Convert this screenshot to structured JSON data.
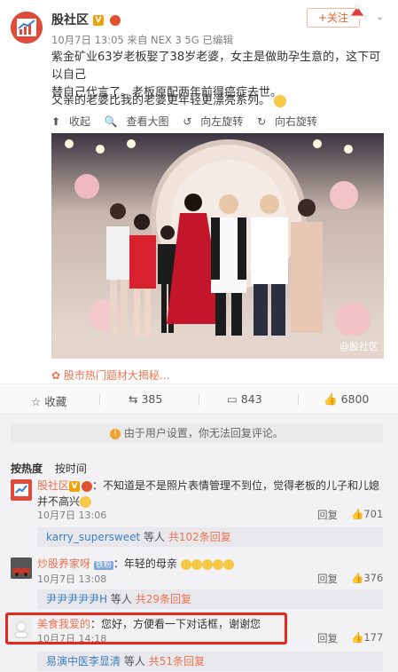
{
  "post": {
    "author": "股社区",
    "v_badge": "V",
    "meta": "10月7日 13:05 来自 NEX 3 5G  已编辑",
    "follow_label": "+关注",
    "text_line1": "紫金矿业63岁老板娶了38岁老婆，女主是做助孕生意的，这下可以自己",
    "text_line2": "替自己代言了。老板原配两年前得癌症去世。",
    "text_line3": "父亲的老婆比我的老婆更年轻更漂亮系列。",
    "toolbar": [
      "收起",
      "查看大图",
      "向左旋转",
      "向右旋转"
    ],
    "watermark": "@股社区",
    "promo": "股市热门题材大揭秘..."
  },
  "actions": {
    "favorite": "收藏",
    "repost": "385",
    "comment": "843",
    "like": "6800"
  },
  "notice": "由于用户设置，你无法回复评论。",
  "sort": [
    "按热度",
    "按时间"
  ],
  "comments": [
    {
      "user": "股社区",
      "text_line1": "：不知道是不是照片表情管理不到位，觉得老板的儿子和儿媳",
      "text_line2": "并不高兴",
      "time": "10月7日 13:06",
      "reply_label": "回复",
      "likes": "701",
      "subreply_user": "karry_supersweet",
      "subreply_mid": "等人",
      "subreply_count": "共102条回复"
    },
    {
      "user": "炒股养家呀",
      "badge": "铁粉",
      "text": "：年轻的母亲",
      "time": "10月7日 13:08",
      "reply_label": "回复",
      "likes": "376",
      "subreply_user": "尹尹尹尹尹H",
      "subreply_mid": "等人",
      "subreply_count": "共29条回复"
    },
    {
      "user": "美食我爱的",
      "text": "：您好，方便看一下对话框，谢谢您",
      "time": "10月7日 14:18",
      "reply_label": "回复",
      "likes": "177",
      "subreply_user": "易演中医李显清",
      "subreply_mid": "等人",
      "subreply_count": "共51条回复"
    }
  ],
  "colors": {
    "accent": "#eb7350",
    "link_blue": "#3c7fc4",
    "highlight_red": "#e4281e"
  }
}
